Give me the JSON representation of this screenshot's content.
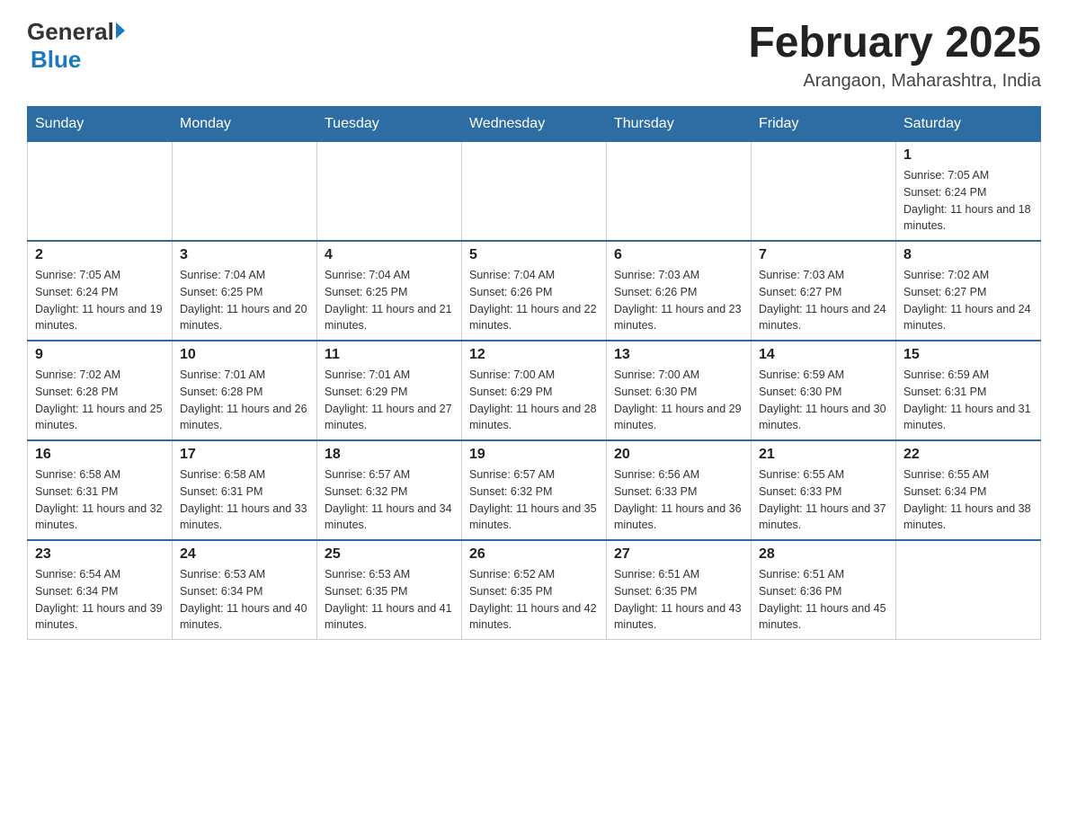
{
  "header": {
    "logo_general": "General",
    "logo_blue": "Blue",
    "month_year": "February 2025",
    "location": "Arangaon, Maharashtra, India"
  },
  "days_of_week": [
    "Sunday",
    "Monday",
    "Tuesday",
    "Wednesday",
    "Thursday",
    "Friday",
    "Saturday"
  ],
  "weeks": [
    [
      {
        "day": "",
        "sunrise": "",
        "sunset": "",
        "daylight": ""
      },
      {
        "day": "",
        "sunrise": "",
        "sunset": "",
        "daylight": ""
      },
      {
        "day": "",
        "sunrise": "",
        "sunset": "",
        "daylight": ""
      },
      {
        "day": "",
        "sunrise": "",
        "sunset": "",
        "daylight": ""
      },
      {
        "day": "",
        "sunrise": "",
        "sunset": "",
        "daylight": ""
      },
      {
        "day": "",
        "sunrise": "",
        "sunset": "",
        "daylight": ""
      },
      {
        "day": "1",
        "sunrise": "Sunrise: 7:05 AM",
        "sunset": "Sunset: 6:24 PM",
        "daylight": "Daylight: 11 hours and 18 minutes."
      }
    ],
    [
      {
        "day": "2",
        "sunrise": "Sunrise: 7:05 AM",
        "sunset": "Sunset: 6:24 PM",
        "daylight": "Daylight: 11 hours and 19 minutes."
      },
      {
        "day": "3",
        "sunrise": "Sunrise: 7:04 AM",
        "sunset": "Sunset: 6:25 PM",
        "daylight": "Daylight: 11 hours and 20 minutes."
      },
      {
        "day": "4",
        "sunrise": "Sunrise: 7:04 AM",
        "sunset": "Sunset: 6:25 PM",
        "daylight": "Daylight: 11 hours and 21 minutes."
      },
      {
        "day": "5",
        "sunrise": "Sunrise: 7:04 AM",
        "sunset": "Sunset: 6:26 PM",
        "daylight": "Daylight: 11 hours and 22 minutes."
      },
      {
        "day": "6",
        "sunrise": "Sunrise: 7:03 AM",
        "sunset": "Sunset: 6:26 PM",
        "daylight": "Daylight: 11 hours and 23 minutes."
      },
      {
        "day": "7",
        "sunrise": "Sunrise: 7:03 AM",
        "sunset": "Sunset: 6:27 PM",
        "daylight": "Daylight: 11 hours and 24 minutes."
      },
      {
        "day": "8",
        "sunrise": "Sunrise: 7:02 AM",
        "sunset": "Sunset: 6:27 PM",
        "daylight": "Daylight: 11 hours and 24 minutes."
      }
    ],
    [
      {
        "day": "9",
        "sunrise": "Sunrise: 7:02 AM",
        "sunset": "Sunset: 6:28 PM",
        "daylight": "Daylight: 11 hours and 25 minutes."
      },
      {
        "day": "10",
        "sunrise": "Sunrise: 7:01 AM",
        "sunset": "Sunset: 6:28 PM",
        "daylight": "Daylight: 11 hours and 26 minutes."
      },
      {
        "day": "11",
        "sunrise": "Sunrise: 7:01 AM",
        "sunset": "Sunset: 6:29 PM",
        "daylight": "Daylight: 11 hours and 27 minutes."
      },
      {
        "day": "12",
        "sunrise": "Sunrise: 7:00 AM",
        "sunset": "Sunset: 6:29 PM",
        "daylight": "Daylight: 11 hours and 28 minutes."
      },
      {
        "day": "13",
        "sunrise": "Sunrise: 7:00 AM",
        "sunset": "Sunset: 6:30 PM",
        "daylight": "Daylight: 11 hours and 29 minutes."
      },
      {
        "day": "14",
        "sunrise": "Sunrise: 6:59 AM",
        "sunset": "Sunset: 6:30 PM",
        "daylight": "Daylight: 11 hours and 30 minutes."
      },
      {
        "day": "15",
        "sunrise": "Sunrise: 6:59 AM",
        "sunset": "Sunset: 6:31 PM",
        "daylight": "Daylight: 11 hours and 31 minutes."
      }
    ],
    [
      {
        "day": "16",
        "sunrise": "Sunrise: 6:58 AM",
        "sunset": "Sunset: 6:31 PM",
        "daylight": "Daylight: 11 hours and 32 minutes."
      },
      {
        "day": "17",
        "sunrise": "Sunrise: 6:58 AM",
        "sunset": "Sunset: 6:31 PM",
        "daylight": "Daylight: 11 hours and 33 minutes."
      },
      {
        "day": "18",
        "sunrise": "Sunrise: 6:57 AM",
        "sunset": "Sunset: 6:32 PM",
        "daylight": "Daylight: 11 hours and 34 minutes."
      },
      {
        "day": "19",
        "sunrise": "Sunrise: 6:57 AM",
        "sunset": "Sunset: 6:32 PM",
        "daylight": "Daylight: 11 hours and 35 minutes."
      },
      {
        "day": "20",
        "sunrise": "Sunrise: 6:56 AM",
        "sunset": "Sunset: 6:33 PM",
        "daylight": "Daylight: 11 hours and 36 minutes."
      },
      {
        "day": "21",
        "sunrise": "Sunrise: 6:55 AM",
        "sunset": "Sunset: 6:33 PM",
        "daylight": "Daylight: 11 hours and 37 minutes."
      },
      {
        "day": "22",
        "sunrise": "Sunrise: 6:55 AM",
        "sunset": "Sunset: 6:34 PM",
        "daylight": "Daylight: 11 hours and 38 minutes."
      }
    ],
    [
      {
        "day": "23",
        "sunrise": "Sunrise: 6:54 AM",
        "sunset": "Sunset: 6:34 PM",
        "daylight": "Daylight: 11 hours and 39 minutes."
      },
      {
        "day": "24",
        "sunrise": "Sunrise: 6:53 AM",
        "sunset": "Sunset: 6:34 PM",
        "daylight": "Daylight: 11 hours and 40 minutes."
      },
      {
        "day": "25",
        "sunrise": "Sunrise: 6:53 AM",
        "sunset": "Sunset: 6:35 PM",
        "daylight": "Daylight: 11 hours and 41 minutes."
      },
      {
        "day": "26",
        "sunrise": "Sunrise: 6:52 AM",
        "sunset": "Sunset: 6:35 PM",
        "daylight": "Daylight: 11 hours and 42 minutes."
      },
      {
        "day": "27",
        "sunrise": "Sunrise: 6:51 AM",
        "sunset": "Sunset: 6:35 PM",
        "daylight": "Daylight: 11 hours and 43 minutes."
      },
      {
        "day": "28",
        "sunrise": "Sunrise: 6:51 AM",
        "sunset": "Sunset: 6:36 PM",
        "daylight": "Daylight: 11 hours and 45 minutes."
      },
      {
        "day": "",
        "sunrise": "",
        "sunset": "",
        "daylight": ""
      }
    ]
  ]
}
